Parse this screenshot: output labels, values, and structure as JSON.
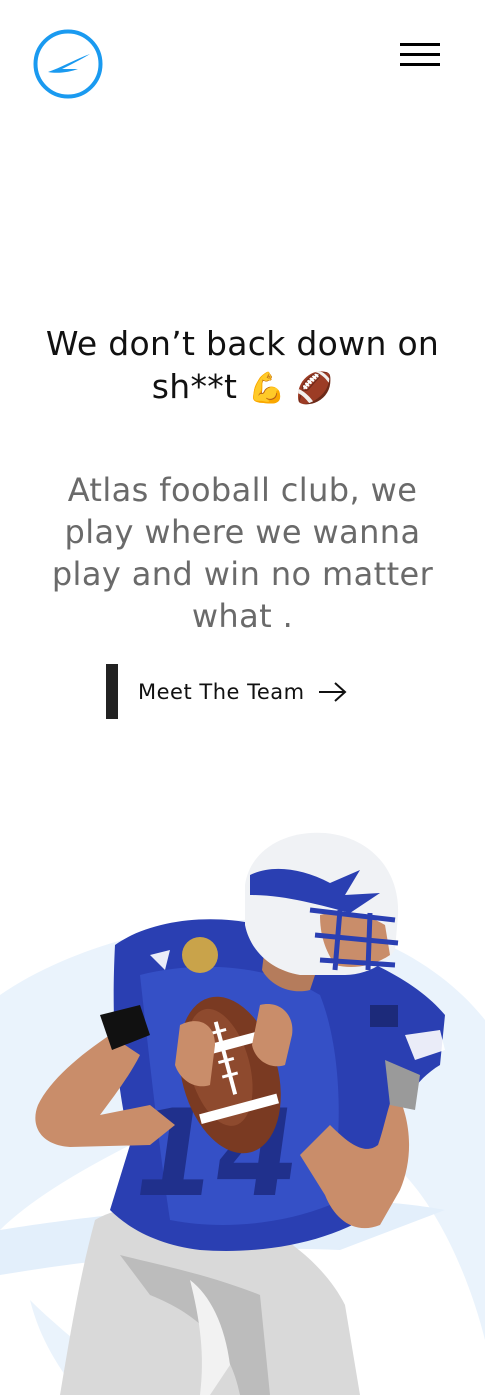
{
  "header": {
    "logo_icon": "atlas-logo-icon",
    "menu_icon": "hamburger-menu-icon"
  },
  "hero": {
    "headline_text": "We don’t back down on sh**t",
    "headline_emoji": "💪 🏈",
    "tagline": "Atlas fooball club, we play where we wanna play and win no matter what .",
    "cta_label": "Meet The Team",
    "cta_icon": "arrow-right-icon"
  },
  "colors": {
    "accent": "#1a9af0",
    "swoosh": "#e6f1fc",
    "text": "#111111",
    "muted": "#6a6a6a",
    "jersey": "#2a3fb2"
  }
}
